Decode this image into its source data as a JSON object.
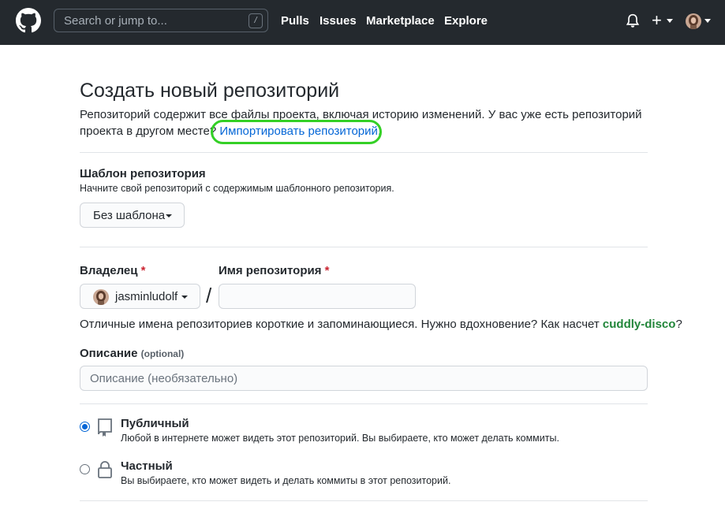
{
  "header": {
    "search_placeholder": "Search or jump to...",
    "search_shortcut": "/",
    "nav": [
      "Pulls",
      "Issues",
      "Marketplace",
      "Explore"
    ],
    "plus_symbol": "+",
    "icons": [
      "github-logo",
      "bell-icon",
      "plus-icon",
      "avatar"
    ],
    "bg_color": "#24292e"
  },
  "page": {
    "title": "Создать новый репозиторий",
    "lead_text": "Репозиторий содержит все файлы проекта, включая историю изменений. У вас уже есть репозиторий проекта в другом месте?",
    "import_link": "Импортировать репозиторий.",
    "highlight_color": "#34d026"
  },
  "template": {
    "label": "Шаблон репозитория",
    "note": "Начните свой репозиторий с содержимым шаблонного репозитория.",
    "button": "Без шаблона"
  },
  "owner": {
    "label": "Владелец",
    "required": "*",
    "value": "jasminludolf"
  },
  "repo_name": {
    "label": "Имя репозитория",
    "required": "*",
    "value": "",
    "separator": "/"
  },
  "hint": {
    "text": "Отличные имена репозиториев короткие и запоминающиеся. Нужно вдохновение? Как насчет",
    "suggestion": "cuddly-disco",
    "end": "?"
  },
  "description": {
    "label": "Описание",
    "optional": "(optional)",
    "placeholder": "Описание (необязательно)"
  },
  "visibility": {
    "selected": "public",
    "options": [
      {
        "title": "Публичный",
        "desc": "Любой в интернете может видеть этот репозиторий. Вы выбираете, кто может делать коммиты.",
        "icon": "repo-icon"
      },
      {
        "title": "Частный",
        "desc": "Вы выбираете, кто может видеть и делать коммиты в этот репозиторий.",
        "icon": "lock-icon"
      }
    ]
  }
}
